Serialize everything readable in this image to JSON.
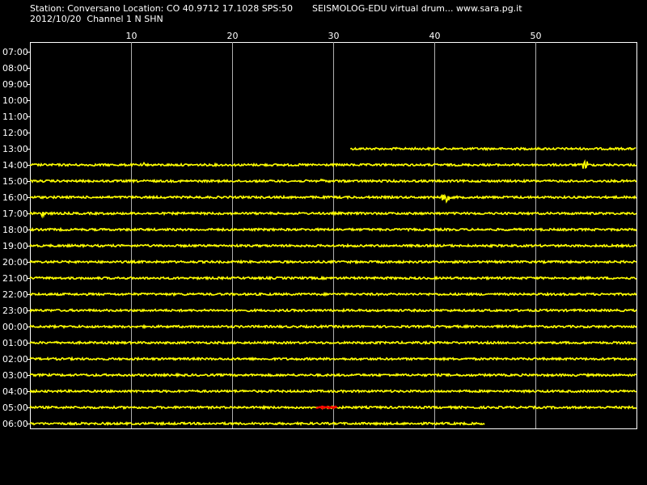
{
  "header": {
    "station_line": "Station: Conversano Location: CO 40.9712 17.1028 SPS:50",
    "date_channel_line": "2012/10/20  Channel 1 N SHN",
    "credit_line": "SEISMOLOG-EDU virtual drum... www.sara.pg.it"
  },
  "colors": {
    "background": "#000000",
    "trace": "#ffff00",
    "event_trace": "#ff0000",
    "grid": "#ffffff",
    "text": "#ffffff"
  },
  "chart_data": {
    "type": "line",
    "title": "",
    "xlabel": "",
    "ylabel": "",
    "x_unit": "minutes",
    "xlim": [
      0,
      60
    ],
    "x_ticks": [
      10,
      20,
      30,
      40,
      50
    ],
    "x_tick_labels": [
      "10",
      "20",
      "30",
      "40",
      "50"
    ],
    "grid": true,
    "categories": [
      "07:00",
      "08:00",
      "09:00",
      "10:00",
      "11:00",
      "12:00",
      "13:00",
      "14:00",
      "15:00",
      "16:00",
      "17:00",
      "18:00",
      "19:00",
      "20:00",
      "21:00",
      "22:00",
      "23:00",
      "00:00",
      "01:00",
      "02:00",
      "03:00",
      "04:00",
      "05:00",
      "06:00"
    ],
    "series": [
      {
        "label": "07:00",
        "start_min": null,
        "end_min": null
      },
      {
        "label": "08:00",
        "start_min": null,
        "end_min": null
      },
      {
        "label": "09:00",
        "start_min": null,
        "end_min": null
      },
      {
        "label": "10:00",
        "start_min": null,
        "end_min": null
      },
      {
        "label": "11:00",
        "start_min": null,
        "end_min": null
      },
      {
        "label": "12:00",
        "start_min": null,
        "end_min": null
      },
      {
        "label": "13:00",
        "start_min": 31.7,
        "end_min": 60,
        "spikes": [
          {
            "at": 35.5,
            "amp": 1
          }
        ]
      },
      {
        "label": "14:00",
        "start_min": 0,
        "end_min": 60,
        "spikes": [
          {
            "at": 11.3,
            "amp": 3
          },
          {
            "at": 35.4,
            "amp": 2
          },
          {
            "at": 54.9,
            "amp": 5
          }
        ]
      },
      {
        "label": "15:00",
        "start_min": 0,
        "end_min": 60,
        "spikes": [
          {
            "at": 28.9,
            "amp": 2
          },
          {
            "at": 54.5,
            "amp": 1
          }
        ]
      },
      {
        "label": "16:00",
        "start_min": 0,
        "end_min": 60,
        "spikes": [
          {
            "at": 40.8,
            "amp": 4
          },
          {
            "at": 41.2,
            "amp": 6
          }
        ]
      },
      {
        "label": "17:00",
        "start_min": 0,
        "end_min": 60,
        "spikes": [
          {
            "at": 1.3,
            "amp": 7
          }
        ]
      },
      {
        "label": "18:00",
        "start_min": 0,
        "end_min": 60
      },
      {
        "label": "19:00",
        "start_min": 0,
        "end_min": 60
      },
      {
        "label": "20:00",
        "start_min": 0,
        "end_min": 60
      },
      {
        "label": "21:00",
        "start_min": 0,
        "end_min": 60
      },
      {
        "label": "22:00",
        "start_min": 0,
        "end_min": 60
      },
      {
        "label": "23:00",
        "start_min": 0,
        "end_min": 60
      },
      {
        "label": "00:00",
        "start_min": 0,
        "end_min": 60
      },
      {
        "label": "01:00",
        "start_min": 0,
        "end_min": 60
      },
      {
        "label": "02:00",
        "start_min": 0,
        "end_min": 60
      },
      {
        "label": "03:00",
        "start_min": 0,
        "end_min": 60
      },
      {
        "label": "04:00",
        "start_min": 0,
        "end_min": 60
      },
      {
        "label": "05:00",
        "start_min": 0,
        "end_min": 60,
        "event": {
          "start_min": 28.3,
          "end_min": 30.4
        }
      },
      {
        "label": "06:00",
        "start_min": 0,
        "end_min": 45
      }
    ]
  }
}
